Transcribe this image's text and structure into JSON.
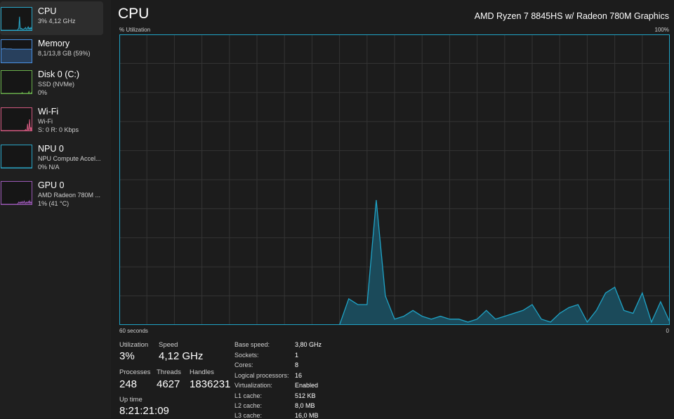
{
  "sidebar": {
    "items": [
      {
        "title": "CPU",
        "line1": "3% 4,12 GHz",
        "line2": "",
        "color": "#2aa6c7",
        "selected": true,
        "spark": [
          0,
          0,
          0,
          0,
          0,
          0,
          0,
          0,
          0,
          0,
          0,
          0,
          0,
          0,
          0,
          0,
          0,
          0,
          0,
          0,
          0,
          0,
          0,
          0,
          0,
          0.06,
          0.1,
          0.6,
          0.12,
          0.05,
          0.08,
          0.04,
          0.05,
          0.04,
          0.06,
          0.08,
          0.12,
          0.05,
          0.04,
          0.1,
          0.15,
          0.05,
          0.1,
          0.04,
          0.12,
          0.06
        ]
      },
      {
        "title": "Memory",
        "line1": "8,1/13,8 GB (59%)",
        "line2": "",
        "color": "#4a90e2",
        "selected": false,
        "spark": [
          0.6,
          0.6,
          0.6,
          0.62,
          0.62,
          0.62,
          0.61,
          0.6,
          0.6,
          0.6,
          0.6,
          0.6,
          0.6,
          0.6,
          0.6,
          0.6,
          0.59,
          0.59,
          0.59,
          0.59,
          0.59,
          0.59,
          0.59,
          0.59,
          0.59,
          0.59,
          0.59,
          0.59,
          0.59,
          0.59,
          0.59,
          0.59,
          0.59,
          0.59,
          0.59,
          0.59,
          0.59,
          0.59,
          0.59,
          0.59,
          0.59,
          0.59,
          0.59,
          0.59,
          0.59,
          0.59
        ]
      },
      {
        "title": "Disk 0 (C:)",
        "line1": "SSD (NVMe)",
        "line2": "0%",
        "color": "#6ab04c",
        "selected": false,
        "spark": [
          0,
          0,
          0,
          0,
          0,
          0,
          0,
          0,
          0,
          0,
          0,
          0,
          0,
          0,
          0,
          0,
          0,
          0,
          0,
          0,
          0,
          0,
          0,
          0,
          0,
          0,
          0,
          0,
          0,
          0,
          0,
          0.04,
          0,
          0,
          0,
          0,
          0,
          0,
          0,
          0,
          0,
          0.08,
          0,
          0,
          0,
          0.05
        ]
      },
      {
        "title": "Wi-Fi",
        "line1": "Wi-Fi",
        "line2": "S: 0 R: 0 Kbps",
        "color": "#d0587e",
        "selected": false,
        "spark": [
          0,
          0,
          0,
          0,
          0,
          0,
          0,
          0,
          0,
          0,
          0,
          0,
          0,
          0,
          0,
          0,
          0,
          0,
          0,
          0,
          0,
          0,
          0,
          0,
          0,
          0,
          0,
          0,
          0,
          0,
          0,
          0,
          0,
          0,
          0,
          0,
          0.05,
          0,
          0,
          0.3,
          0,
          0.1,
          0.5,
          0,
          0.15,
          0
        ]
      },
      {
        "title": "NPU 0",
        "line1": "NPU Compute Accel...",
        "line2": "0% N/A",
        "color": "#2aa6c7",
        "selected": false,
        "spark": [
          0,
          0,
          0,
          0,
          0,
          0,
          0,
          0,
          0,
          0,
          0,
          0,
          0,
          0,
          0,
          0,
          0,
          0,
          0,
          0,
          0,
          0,
          0,
          0,
          0,
          0,
          0,
          0,
          0,
          0,
          0,
          0,
          0,
          0,
          0,
          0,
          0,
          0,
          0,
          0,
          0,
          0,
          0,
          0,
          0,
          0
        ]
      },
      {
        "title": "GPU 0",
        "line1": "AMD Radeon 780M ...",
        "line2": "1% (41 °C)",
        "color": "#9b59b6",
        "selected": false,
        "spark": [
          0,
          0,
          0,
          0,
          0,
          0,
          0,
          0,
          0,
          0,
          0,
          0,
          0,
          0,
          0,
          0,
          0,
          0,
          0,
          0,
          0,
          0,
          0,
          0,
          0,
          0.05,
          0.1,
          0.08,
          0.04,
          0.1,
          0.06,
          0.12,
          0.05,
          0.08,
          0.14,
          0.06,
          0.04,
          0.1,
          0.05,
          0.08,
          0.12,
          0.06,
          0.15,
          0.05,
          0.1,
          0.04
        ]
      }
    ]
  },
  "header": {
    "title": "CPU",
    "cpu_model": "AMD Ryzen 7 8845HS w/ Radeon 780M Graphics"
  },
  "graph": {
    "y_label": "% Utilization",
    "y_max_label": "100%",
    "x_left_label": "60 seconds",
    "x_right_label": "0",
    "line_color": "#1fa3c6",
    "fill_color": "#1b4a5a",
    "grid_color": "#343434"
  },
  "chart_data": {
    "type": "area",
    "ylim": [
      0,
      100
    ],
    "xlim": [
      60,
      0
    ],
    "x": [
      60,
      59,
      58,
      57,
      56,
      55,
      54,
      53,
      52,
      51,
      50,
      49,
      48,
      47,
      46,
      45,
      44,
      43,
      42,
      41,
      40,
      39,
      38,
      37,
      36,
      35,
      34,
      33,
      32,
      31,
      30,
      29,
      28,
      27,
      26,
      25,
      24,
      23,
      22,
      21,
      20,
      19,
      18,
      17,
      16,
      15,
      14,
      13,
      12,
      11,
      10,
      9,
      8,
      7,
      6,
      5,
      4,
      3,
      2,
      1,
      0
    ],
    "values": [
      0,
      0,
      0,
      0,
      0,
      0,
      0,
      0,
      0,
      0,
      0,
      0,
      0,
      0,
      0,
      0,
      0,
      0,
      0,
      0,
      0,
      0,
      0,
      0,
      0,
      9,
      7,
      7,
      43,
      10,
      2,
      3,
      5,
      3,
      2,
      3,
      2,
      2,
      1,
      2,
      5,
      2,
      3,
      4,
      5,
      7,
      2,
      1,
      4,
      6,
      7,
      1,
      5,
      11,
      13,
      5,
      4,
      11,
      1,
      8,
      1
    ],
    "grid": true
  },
  "stats": {
    "utilization_label": "Utilization",
    "utilization_value": "3%",
    "speed_label": "Speed",
    "speed_value": "4,12 GHz",
    "processes_label": "Processes",
    "processes_value": "248",
    "threads_label": "Threads",
    "threads_value": "4627",
    "handles_label": "Handles",
    "handles_value": "1836231",
    "uptime_label": "Up time",
    "uptime_value": "8:21:21:09"
  },
  "specs": [
    {
      "label": "Base speed:",
      "value": "3,80 GHz"
    },
    {
      "label": "Sockets:",
      "value": "1"
    },
    {
      "label": "Cores:",
      "value": "8"
    },
    {
      "label": "Logical processors:",
      "value": "16"
    },
    {
      "label": "Virtualization:",
      "value": "Enabled"
    },
    {
      "label": "L1 cache:",
      "value": "512 KB"
    },
    {
      "label": "L2 cache:",
      "value": "8,0 MB"
    },
    {
      "label": "L3 cache:",
      "value": "16,0 MB"
    }
  ]
}
